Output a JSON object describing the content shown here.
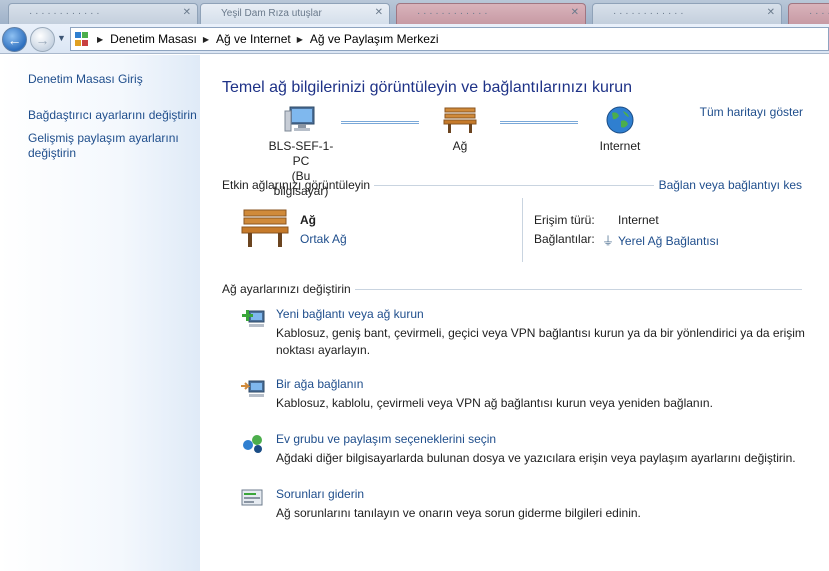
{
  "tabs": [
    {
      "label": "· · · · · · · · · · · ·"
    },
    {
      "label": "· · · · · · · · · · · ·"
    },
    {
      "label": "Yeşil Dam Rıza utuşlar"
    },
    {
      "label": "· · · · · · · · · · · ·"
    },
    {
      "label": "· · · · · · · · · · · ·"
    },
    {
      "label": "· · · · · · · · · · · ·"
    }
  ],
  "address": {
    "crumbs": [
      "Denetim Masası",
      "Ağ ve Internet",
      "Ağ ve Paylaşım Merkezi"
    ]
  },
  "sidebar": {
    "items": [
      {
        "label": "Denetim Masası Giriş"
      },
      {
        "label": "Bağdaştırıcı ayarlarını değiştirin"
      },
      {
        "label": "Gelişmiş paylaşım ayarlarını\ndeğiştirin"
      }
    ]
  },
  "main": {
    "title": "Temel ağ bilgilerinizi görüntüleyin ve bağlantılarınızı kurun",
    "full_map_link": "Tüm haritayı göster",
    "map": {
      "computer": {
        "name": "BLS-SEF-1-PC",
        "sub": "(Bu bilgisayar)"
      },
      "network": {
        "name": "Ağ"
      },
      "internet": {
        "name": "Internet"
      }
    },
    "active_networks": {
      "heading": "Etkin ağlarınızı görüntüleyin",
      "toggle_link": "Bağlan veya bağlantıyı kes",
      "network_name": "Ağ",
      "network_type": "Ortak Ağ",
      "access_type_label": "Erişim türü:",
      "access_type_value": "Internet",
      "connections_label": "Bağlantılar:",
      "connections_value": "Yerel Ağ Bağlantısı"
    },
    "change_settings": {
      "heading": "Ağ ayarlarınızı değiştirin",
      "tasks": [
        {
          "title": "Yeni bağlantı veya ağ kurun",
          "desc": "Kablosuz, geniş bant, çevirmeli, geçici veya VPN bağlantısı kurun ya da bir yönlendirici ya da erişim noktası ayarlayın."
        },
        {
          "title": "Bir ağa bağlanın",
          "desc": "Kablosuz, kablolu, çevirmeli veya VPN ağ bağlantısı kurun veya yeniden bağlanın."
        },
        {
          "title": "Ev grubu ve paylaşım seçeneklerini seçin",
          "desc": "Ağdaki diğer bilgisayarlarda bulunan dosya ve yazıcılara erişin veya paylaşım ayarlarını değiştirin."
        },
        {
          "title": "Sorunları giderin",
          "desc": "Ağ sorunlarını tanılayın ve onarın veya sorun giderme bilgileri edinin."
        }
      ]
    }
  }
}
